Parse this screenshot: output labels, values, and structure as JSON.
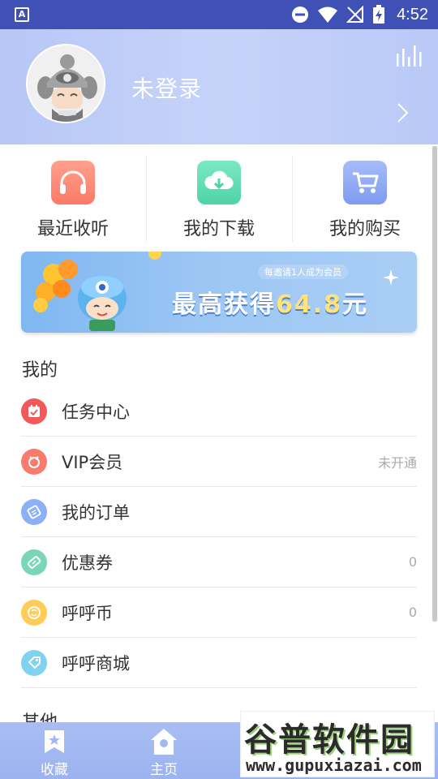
{
  "status_bar": {
    "app_indicator": "A",
    "time": "4:52",
    "icons": [
      "do-not-disturb-icon",
      "wifi-icon",
      "no-signal-icon",
      "battery-charging-icon"
    ]
  },
  "profile": {
    "login_status": "未登录"
  },
  "shortcuts": [
    {
      "label": "最近收听",
      "icon": "headphones-icon",
      "color": "#ff8a78"
    },
    {
      "label": "我的下载",
      "icon": "download-cloud-icon",
      "color": "#5fdbb3"
    },
    {
      "label": "我的购买",
      "icon": "cart-icon",
      "color": "#8fa8f3"
    }
  ],
  "banner": {
    "small_text": "每邀请1人成为会员",
    "main_prefix": "最高获得",
    "amount": "64.8",
    "unit": "元"
  },
  "section_mine": {
    "title": "我的",
    "items": [
      {
        "label": "任务中心",
        "value": "",
        "icon": "task-icon",
        "color": "#f25a5a"
      },
      {
        "label": "VIP会员",
        "value": "未开通",
        "icon": "vip-icon",
        "color": "#f87c6e"
      },
      {
        "label": "我的订单",
        "value": "",
        "icon": "order-icon",
        "color": "#8ab1f5"
      },
      {
        "label": "优惠券",
        "value": "0",
        "icon": "coupon-icon",
        "color": "#7ad7b6"
      },
      {
        "label": "呼呼币",
        "value": "0",
        "icon": "coin-icon",
        "color": "#ffcd57"
      },
      {
        "label": "呼呼商城",
        "value": "",
        "icon": "shop-icon",
        "color": "#7fd3ee"
      }
    ]
  },
  "section_other": {
    "title": "其他"
  },
  "bottom_nav": [
    {
      "label": "收藏",
      "icon": "favorites-icon"
    },
    {
      "label": "主页",
      "icon": "home-icon"
    }
  ],
  "watermark": {
    "text": "谷普软件园",
    "url": "www.gupuxiazai.com"
  },
  "colors": {
    "status_bar": "#3f51b5",
    "header": "#c0cef8",
    "bottom_nav": "#a3b8f1"
  }
}
